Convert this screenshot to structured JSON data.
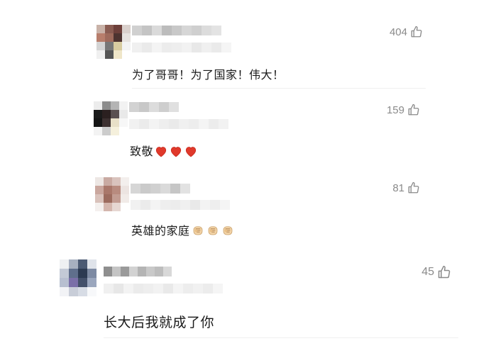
{
  "comments": [
    {
      "likes": "404",
      "text": "为了哥哥！为了国家！伟大！",
      "emoji": ""
    },
    {
      "likes": "159",
      "text": "致敬",
      "emoji": "❤❤❤"
    },
    {
      "likes": "81",
      "text": "英雄的家庭",
      "emoji": "fist fist fist"
    },
    {
      "likes": "45",
      "text": "长大后我就成了你",
      "emoji": ""
    }
  ]
}
